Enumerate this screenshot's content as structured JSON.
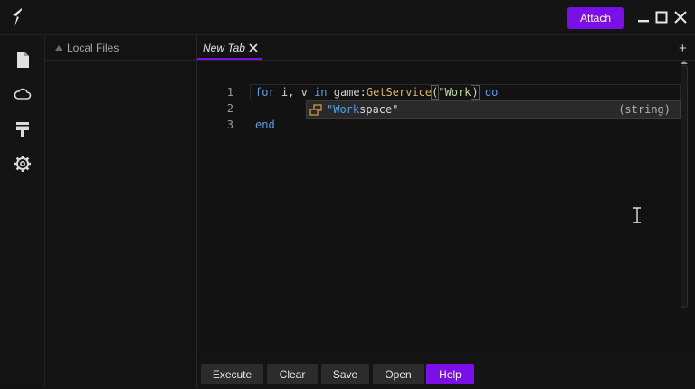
{
  "titlebar": {
    "attach_label": "Attach",
    "logo_icon": "app-logo-icon",
    "minimize_icon": "minimize-icon",
    "maximize_icon": "maximize-icon",
    "close_icon": "close-icon",
    "accent": "#7b0fe8"
  },
  "sidebar": {
    "items": [
      {
        "icon": "file-icon"
      },
      {
        "icon": "cloud-icon"
      },
      {
        "icon": "paint-roller-icon"
      },
      {
        "icon": "gear-icon"
      }
    ]
  },
  "files": {
    "header": "Local Files"
  },
  "tabs": [
    {
      "label": "New Tab"
    }
  ],
  "new_tab_symbol": "+",
  "editor": {
    "line_numbers": [
      "1",
      "2",
      "3"
    ],
    "line1": {
      "kw_for": "for",
      "vars": " i, v ",
      "kw_in": "in",
      "obj": " game:",
      "fn": "GetService",
      "open_paren": "(",
      "string_typed": "\"Work",
      "close_paren": ")",
      "kw_do": "do"
    },
    "line3": "end",
    "autocomplete": {
      "match": "\"Work",
      "rest": "space\"",
      "type": "(string)"
    }
  },
  "toolbar": {
    "buttons": [
      "Execute",
      "Clear",
      "Save",
      "Open",
      "Help"
    ]
  }
}
